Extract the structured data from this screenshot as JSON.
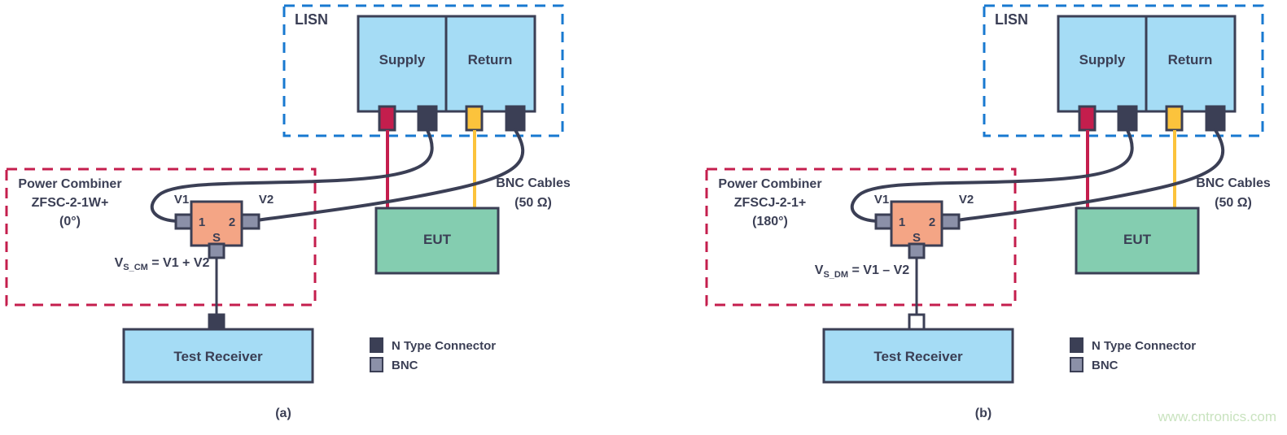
{
  "figure": {
    "title": "EMI measurement setups using power combiners for CM and DM noise separation",
    "watermark": "www.cntronics.com"
  },
  "colors": {
    "outline": "#3b3f55",
    "lisn_dash": "#1879d0",
    "combiner_dash": "#c41e4d",
    "box_blue": "#a5dcf5",
    "box_green": "#84cdb0",
    "combiner_fill": "#f4a585",
    "connector_n": "#3b3f55",
    "connector_bnc": "#8b90a8",
    "cable_red": "#c41e4d",
    "cable_yellow": "#fcc33c",
    "cable_dark": "#3b3f55",
    "text": "#3b3f55",
    "watermark": "#c9e3bf"
  },
  "legend": {
    "items": [
      {
        "label": "N Type Connector",
        "swatch": "connector-n-type",
        "color": "#3b3f55"
      },
      {
        "label": "BNC",
        "swatch": "connector-bnc",
        "color": "#8b90a8"
      }
    ]
  },
  "panels": [
    {
      "id": "a",
      "caption": "(a)",
      "lisn": {
        "group_label": "LISN",
        "blocks": [
          {
            "label": "Supply"
          },
          {
            "label": "Return"
          }
        ],
        "connectors": [
          {
            "name": "supply-power-connector",
            "type": "power",
            "color": "#c41e4d"
          },
          {
            "name": "supply-rf-connector",
            "type": "n-type",
            "color": "#3b3f55"
          },
          {
            "name": "return-power-connector",
            "type": "power",
            "color": "#fcc33c"
          },
          {
            "name": "return-rf-connector",
            "type": "n-type",
            "color": "#3b3f55"
          }
        ]
      },
      "combiner": {
        "group_title": "Power Combiner",
        "part_number": "ZFSC-2-1W+",
        "phase": "(0°)",
        "port_labels": {
          "left": "V1",
          "right": "V2"
        },
        "port_numbers": {
          "left": "1",
          "right": "2",
          "sum": "S"
        },
        "equation": {
          "symbol": "V",
          "subscript": "S_CM",
          "expression": "= V1 + V2"
        },
        "output_connector_type": "n-type"
      },
      "eut": {
        "label": "EUT"
      },
      "receiver": {
        "label": "Test Receiver"
      },
      "cables_note": {
        "line1": "BNC Cables",
        "line2": "(50 Ω)"
      }
    },
    {
      "id": "b",
      "caption": "(b)",
      "lisn": {
        "group_label": "LISN",
        "blocks": [
          {
            "label": "Supply"
          },
          {
            "label": "Return"
          }
        ],
        "connectors": [
          {
            "name": "supply-power-connector",
            "type": "power",
            "color": "#c41e4d"
          },
          {
            "name": "supply-rf-connector",
            "type": "n-type",
            "color": "#3b3f55"
          },
          {
            "name": "return-power-connector",
            "type": "power",
            "color": "#fcc33c"
          },
          {
            "name": "return-rf-connector",
            "type": "n-type",
            "color": "#3b3f55"
          }
        ]
      },
      "combiner": {
        "group_title": "Power Combiner",
        "part_number": "ZFSCJ-2-1+",
        "phase": "(180°)",
        "port_labels": {
          "left": "V1",
          "right": "V2"
        },
        "port_numbers": {
          "left": "1",
          "right": "2",
          "sum": "S"
        },
        "equation": {
          "symbol": "V",
          "subscript": "S_DM",
          "expression": "= V1 – V2"
        },
        "output_connector_type": "open"
      },
      "eut": {
        "label": "EUT"
      },
      "receiver": {
        "label": "Test Receiver"
      },
      "cables_note": {
        "line1": "BNC Cables",
        "line2": "(50 Ω)"
      }
    }
  ]
}
